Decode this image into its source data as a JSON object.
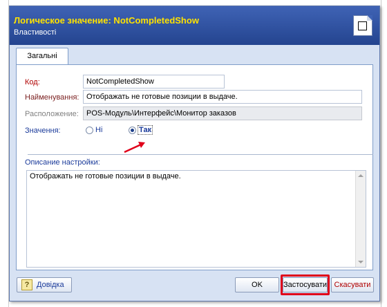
{
  "dialog": {
    "title": "Логическое значение:  NotCompletedShow",
    "subtitle": "Властивості",
    "title_icon": "checkbox-document-icon"
  },
  "tabs": [
    {
      "label": "Загальні",
      "active": true
    }
  ],
  "form": {
    "code": {
      "label": "Код:",
      "value": "NotCompletedShow"
    },
    "name": {
      "label": "Найменування:",
      "value": "Отображать не готовые позиции в выдаче."
    },
    "location": {
      "label": "Расположение:",
      "value": "POS-Модуль\\Интерфейс\\Монитор заказов"
    },
    "value": {
      "label": "Значення:",
      "options": [
        {
          "label": "Ні",
          "selected": false
        },
        {
          "label": "Так",
          "selected": true
        }
      ]
    },
    "description": {
      "label": "Описание настройки:",
      "text": "Отображать не готовые позиции в выдаче."
    }
  },
  "buttons": {
    "help": "Довідка",
    "ok": "OK",
    "apply": "Застосувати",
    "cancel": "Скасувати"
  },
  "colors": {
    "titlebar": "#2c4ea0",
    "title_text": "#ffe200",
    "highlight": "#e0001a",
    "annotation_arrow": "#e0001a"
  }
}
